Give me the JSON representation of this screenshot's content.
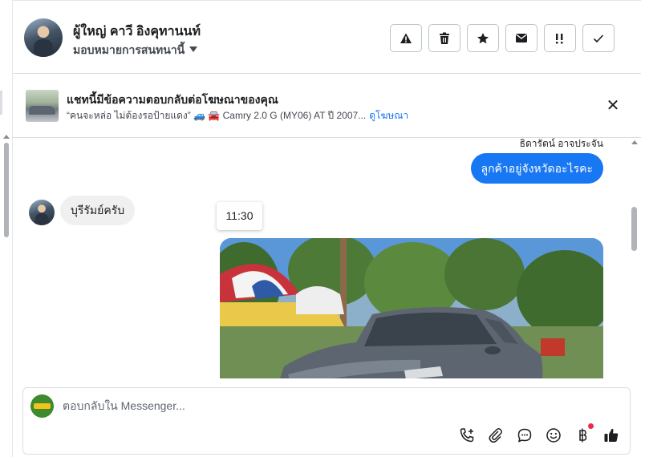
{
  "header": {
    "contact_name": "ผู้ใหญ่ คาวี อิงคุทานนท์",
    "assign_label": "มอบหมายการสนทนานี้",
    "actions": [
      {
        "name": "report-spam-button",
        "icon": "warning-icon"
      },
      {
        "name": "delete-button",
        "icon": "trash-icon"
      },
      {
        "name": "star-button",
        "icon": "star-icon"
      },
      {
        "name": "mark-unread-button",
        "icon": "envelope-icon"
      },
      {
        "name": "follow-up-button",
        "icon": "flag-icon"
      },
      {
        "name": "mark-done-button",
        "icon": "check-icon"
      }
    ]
  },
  "ad_banner": {
    "title": "แชทนี้มีข้อความตอบกลับต่อโฆษณาของคุณ",
    "subtitle": "“คนจะหล่อ ไม่ต้องรอป้ายแดง” 🚙 🚘 Camry 2.0 G (MY06) AT ปี 2007...",
    "link": "ดูโฆษณา"
  },
  "chat": {
    "sender_name": "ธิดารัตน์ อาจประจัน",
    "outgoing_message": "ลูกค้าอยู่จังหวัดอะไรคะ",
    "incoming_message": "บุรีรัมย์ครับ",
    "timestamp": "11:30"
  },
  "composer": {
    "placeholder": "ตอบกลับใน Messenger..."
  },
  "colors": {
    "accent": "#1877f2",
    "incoming_bubble": "#f0f0f0",
    "notification_dot": "#f02849"
  }
}
